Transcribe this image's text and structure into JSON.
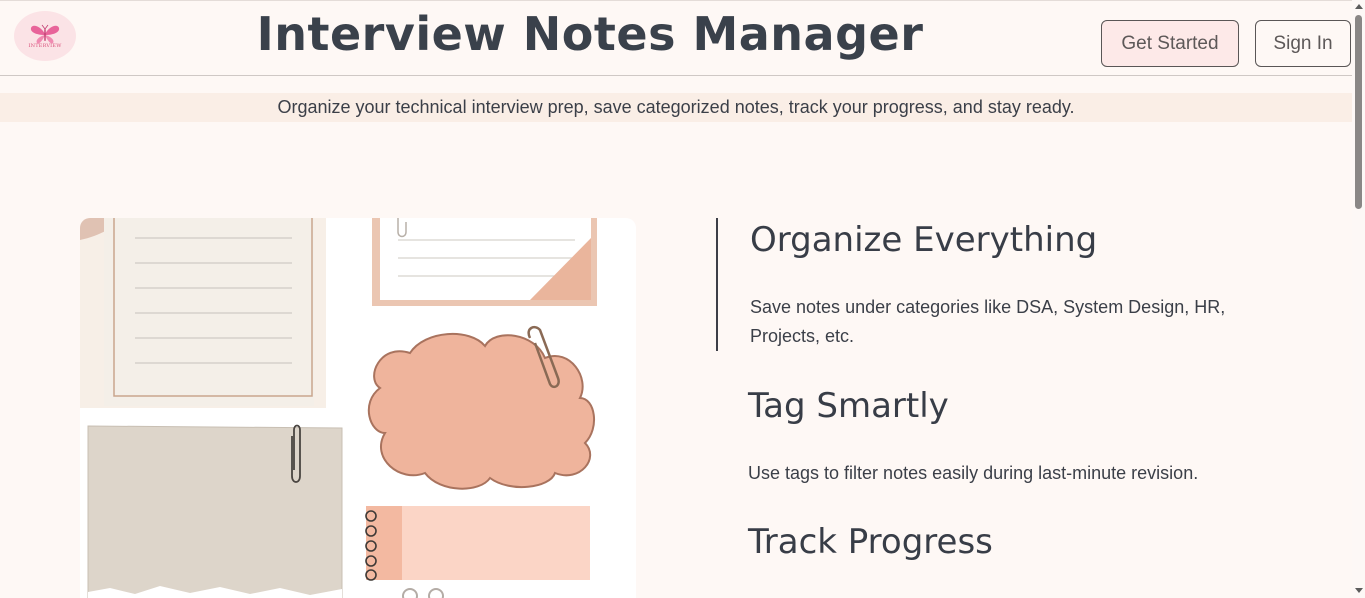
{
  "header": {
    "logo_text": "INTERVIEW",
    "title": "Interview Notes Manager",
    "get_started_label": "Get Started",
    "sign_in_label": "Sign In"
  },
  "tagline": "Organize your technical interview prep, save categorized notes, track your progress, and stay ready.",
  "features": [
    {
      "title": "Organize Everything",
      "description": "Save notes under categories like DSA, System Design, HR, Projects, etc."
    },
    {
      "title": "Tag Smartly",
      "description": "Use tags to filter notes easily during last-minute revision."
    },
    {
      "title": "Track Progress"
    }
  ],
  "colors": {
    "background": "#fef8f5",
    "tagline_band": "#faeee6",
    "get_started_bg": "#fde9e8",
    "text": "#3b3f48",
    "accent_pink": "#e8649a"
  },
  "icons": {
    "logo": "butterfly-icon"
  }
}
